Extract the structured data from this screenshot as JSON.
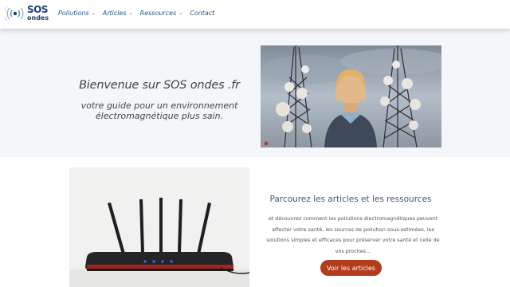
{
  "header": {
    "logo": {
      "text_main": "SOS",
      "text_sub": "ondes"
    },
    "nav": [
      {
        "label": "Pollutions",
        "has_dropdown": true
      },
      {
        "label": "Articles",
        "has_dropdown": true
      },
      {
        "label": "Ressources",
        "has_dropdown": true
      },
      {
        "label": "Contact",
        "has_dropdown": false
      }
    ]
  },
  "hero": {
    "title": "Bienvenue sur SOS ondes .fr",
    "subtitle": "votre guide pour un environnement électromagnétique plus sain."
  },
  "section": {
    "title": "Parcourez les articles et les ressources",
    "body": "et découvrez comment les pollutions électromagnétiques peuvent affecter votre santé, les sources de pollution sous-estimées, les solutions simples et efficaces pour préserver votre santé et celle de vos proches…",
    "button_label": "Voir les articles"
  },
  "colors": {
    "brand": "#1c3f73",
    "nav": "#2a5a8a",
    "hero_bg": "#f4f6f9",
    "button": "#b23c1c"
  }
}
